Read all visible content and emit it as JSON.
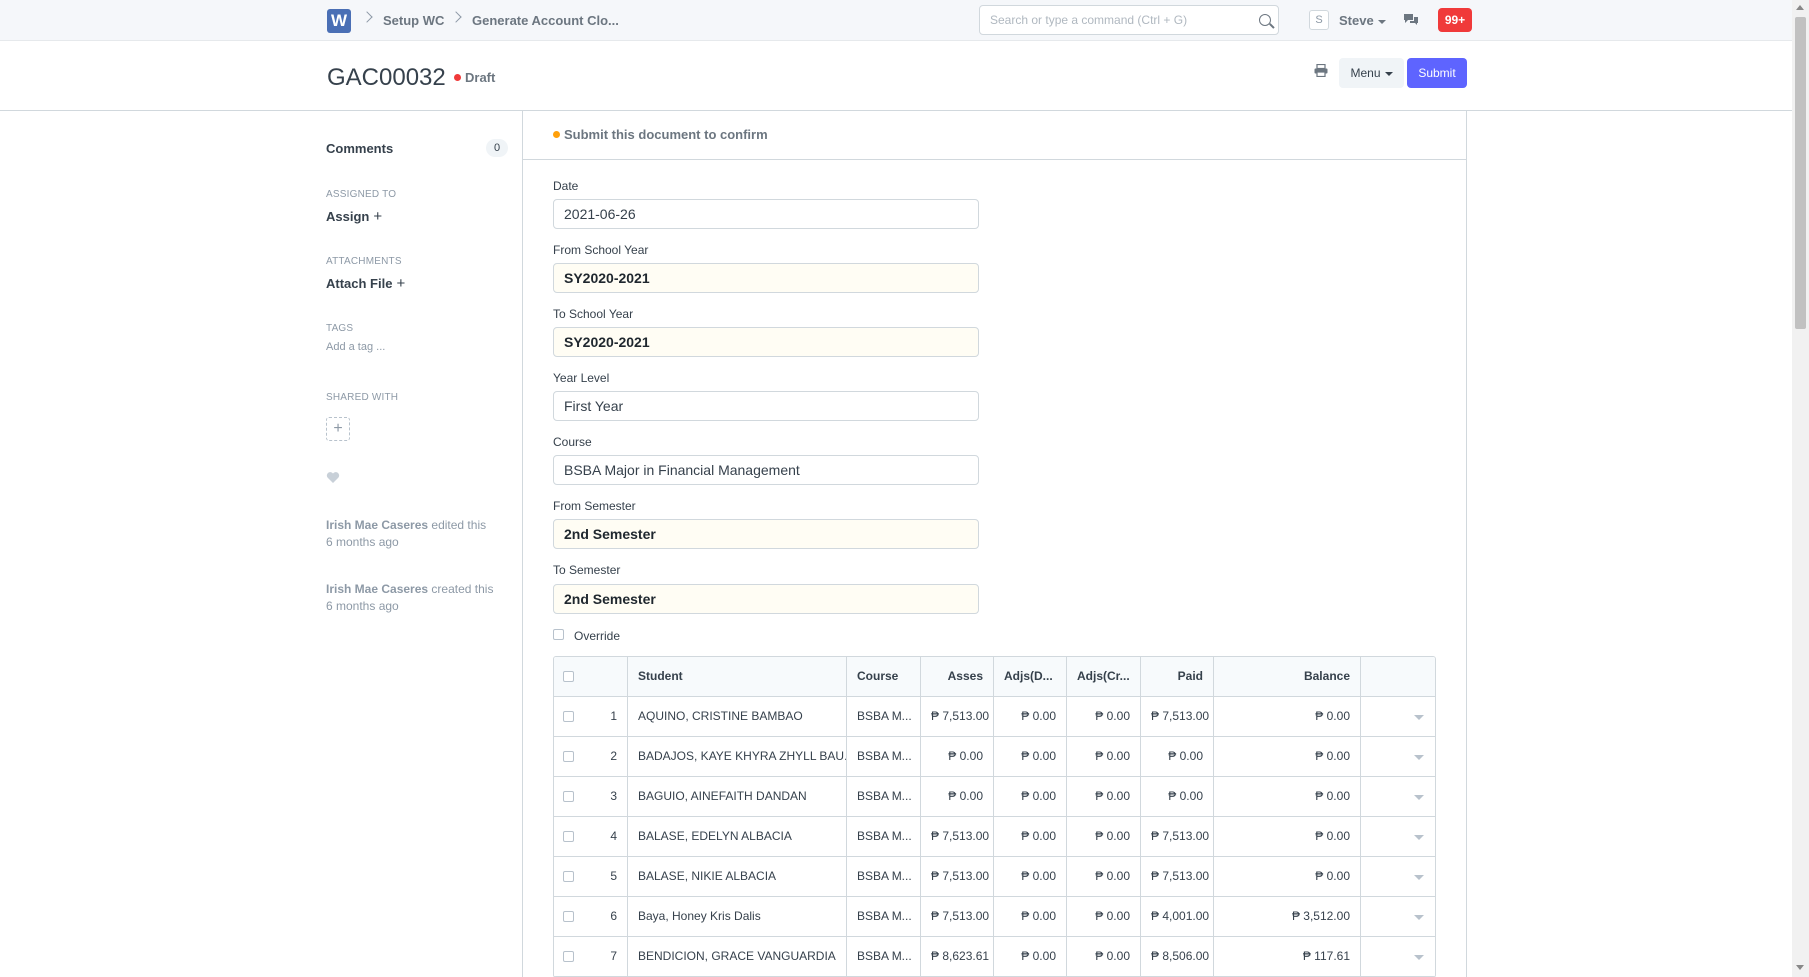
{
  "navbar": {
    "logo_letter": "W",
    "breadcrumbs": [
      "Setup WC",
      "Generate Account Clo..."
    ],
    "search_placeholder": "Search or type a command (Ctrl + G)",
    "avatar_letter": "S",
    "user_name": "Steve",
    "notification_count": "99+"
  },
  "page": {
    "title": "GAC00032",
    "status": "Draft",
    "status_color": "#f03a3a",
    "menu_label": "Menu",
    "submit_label": "Submit"
  },
  "sidebar": {
    "comments_label": "Comments",
    "comments_count": "0",
    "assigned_to_label": "ASSIGNED TO",
    "assign_label": "Assign",
    "attachments_label": "ATTACHMENTS",
    "attach_label": "Attach File",
    "tags_label": "TAGS",
    "add_tag_label": "Add a tag ...",
    "shared_with_label": "SHARED WITH",
    "activity": [
      {
        "user": "Irish Mae Caseres",
        "action": "edited this",
        "time": "6 months ago"
      },
      {
        "user": "Irish Mae Caseres",
        "action": "created this",
        "time": "6 months ago"
      }
    ]
  },
  "alert": {
    "text": "Submit this document to confirm",
    "color": "#ffa00a"
  },
  "form": {
    "date_label": "Date",
    "date_value": "2021-06-26",
    "from_school_year_label": "From School Year",
    "from_school_year_value": "SY2020-2021",
    "to_school_year_label": "To School Year",
    "to_school_year_value": "SY2020-2021",
    "year_level_label": "Year Level",
    "year_level_value": "First Year",
    "course_label": "Course",
    "course_value": "BSBA Major in Financial Management",
    "from_semester_label": "From Semester",
    "from_semester_value": "2nd Semester",
    "to_semester_label": "To Semester",
    "to_semester_value": "2nd Semester",
    "override_label": "Override"
  },
  "table": {
    "headers": [
      "Student",
      "Course",
      "Asses",
      "Adjs(D...",
      "Adjs(Cr...",
      "Paid",
      "Balance"
    ],
    "rows": [
      {
        "no": "1",
        "student": "AQUINO, CRISTINE BAMBAO",
        "course": "BSBA M...",
        "asses": "₱ 7,513.00",
        "adjd": "₱ 0.00",
        "adjc": "₱ 0.00",
        "paid": "₱ 7,513.00",
        "balance": "₱ 0.00"
      },
      {
        "no": "2",
        "student": "BADAJOS, KAYE KHYRA ZHYLL BAU...",
        "course": "BSBA M...",
        "asses": "₱ 0.00",
        "adjd": "₱ 0.00",
        "adjc": "₱ 0.00",
        "paid": "₱ 0.00",
        "balance": "₱ 0.00"
      },
      {
        "no": "3",
        "student": "BAGUIO, AINEFAITH DANDAN",
        "course": "BSBA M...",
        "asses": "₱ 0.00",
        "adjd": "₱ 0.00",
        "adjc": "₱ 0.00",
        "paid": "₱ 0.00",
        "balance": "₱ 0.00"
      },
      {
        "no": "4",
        "student": "BALASE, EDELYN ALBACIA",
        "course": "BSBA M...",
        "asses": "₱ 7,513.00",
        "adjd": "₱ 0.00",
        "adjc": "₱ 0.00",
        "paid": "₱ 7,513.00",
        "balance": "₱ 0.00"
      },
      {
        "no": "5",
        "student": "BALASE, NIKIE ALBACIA",
        "course": "BSBA M...",
        "asses": "₱ 7,513.00",
        "adjd": "₱ 0.00",
        "adjc": "₱ 0.00",
        "paid": "₱ 7,513.00",
        "balance": "₱ 0.00"
      },
      {
        "no": "6",
        "student": "Baya, Honey Kris Dalis",
        "course": "BSBA M...",
        "asses": "₱ 7,513.00",
        "adjd": "₱ 0.00",
        "adjc": "₱ 0.00",
        "paid": "₱ 4,001.00",
        "balance": "₱ 3,512.00"
      },
      {
        "no": "7",
        "student": "BENDICION, GRACE VANGUARDIA",
        "course": "BSBA M...",
        "asses": "₱ 8,623.61",
        "adjd": "₱ 0.00",
        "adjc": "₱ 0.00",
        "paid": "₱ 8,506.00",
        "balance": "₱ 117.61"
      }
    ]
  }
}
